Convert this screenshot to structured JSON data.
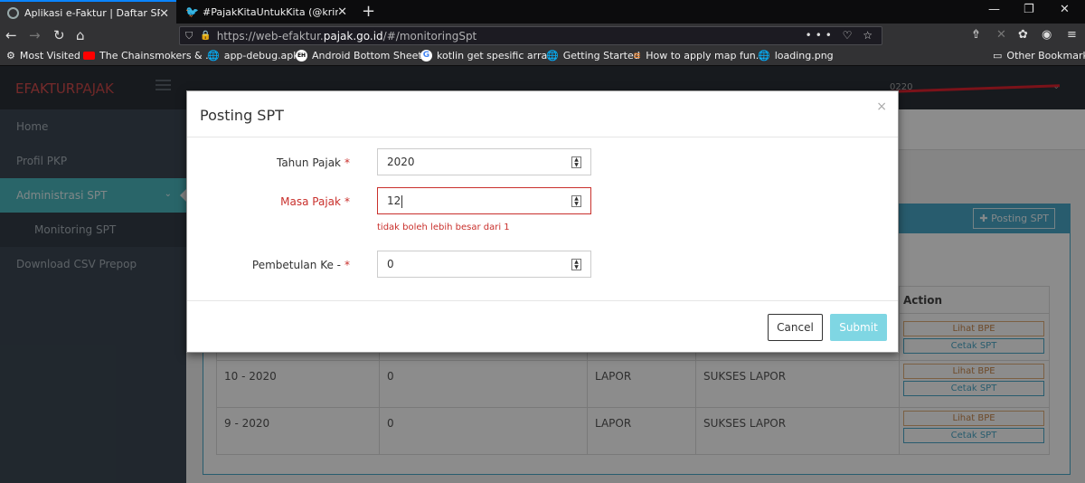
{
  "browser": {
    "tabs": [
      {
        "title": "Aplikasi e-Faktur | Daftar SPT",
        "icon": "efaktur-favicon-icon",
        "active": true
      },
      {
        "title": "#PajakKitaUntukKita (@kring_p",
        "icon": "twitter-icon",
        "active": false
      }
    ],
    "url_prefix": "https://web-efaktur.",
    "url_host": "pajak.go.id",
    "url_suffix": "/#/monitoringSpt",
    "bookmarks": [
      {
        "label": "Most Visited",
        "icon": "gear-icon"
      },
      {
        "label": "The Chainsmokers & ...",
        "icon": "youtube-icon"
      },
      {
        "label": "app-debug.apk",
        "icon": "globe-icon"
      },
      {
        "label": "Android Bottom Sheet...",
        "icon": "eh-icon"
      },
      {
        "label": "kotlin get spesific arra...",
        "icon": "google-icon"
      },
      {
        "label": "Getting Started",
        "icon": "globe-icon"
      },
      {
        "label": "How to apply map fun...",
        "icon": "stackoverflow-icon"
      },
      {
        "label": "loading.png",
        "icon": "globe-icon"
      }
    ],
    "other_bookmarks": "Other Bookmarks"
  },
  "app": {
    "brand_first": "EFAKTUR",
    "brand_second": "PAJAK",
    "user_visible": "0220",
    "sidebar": [
      {
        "label": "Home"
      },
      {
        "label": "Profil PKP"
      },
      {
        "label": "Administrasi SPT"
      },
      {
        "label": "Monitoring SPT"
      },
      {
        "label": "Download CSV Prepop"
      }
    ],
    "posting_button": "Posting SPT",
    "table": {
      "action_header": "Action",
      "rows": [
        {
          "period": "10 - 2020",
          "pembetulan": "0",
          "status": "LAPOR",
          "keterangan": "SUKSES LAPOR"
        },
        {
          "period": "9 - 2020",
          "pembetulan": "0",
          "status": "LAPOR",
          "keterangan": "SUKSES LAPOR"
        }
      ],
      "lihat_bpe": "Lihat BPE",
      "cetak_spt": "Cetak SPT"
    }
  },
  "modal": {
    "title": "Posting SPT",
    "close": "×",
    "fields": {
      "tahun_label": "Tahun Pajak",
      "tahun_value": "2020",
      "masa_label": "Masa Pajak",
      "masa_value": "12",
      "masa_error": "tidak boleh lebih besar dari 1",
      "pembetulan_label": "Pembetulan Ke -",
      "pembetulan_value": "0",
      "required_mark": "*"
    },
    "cancel": "Cancel",
    "submit": "Submit"
  },
  "colors": {
    "accent": "#4aa8c8",
    "sidebar_active": "#4bb9bf",
    "error": "#c9302c",
    "submit_disabled": "#7fd6e3"
  }
}
